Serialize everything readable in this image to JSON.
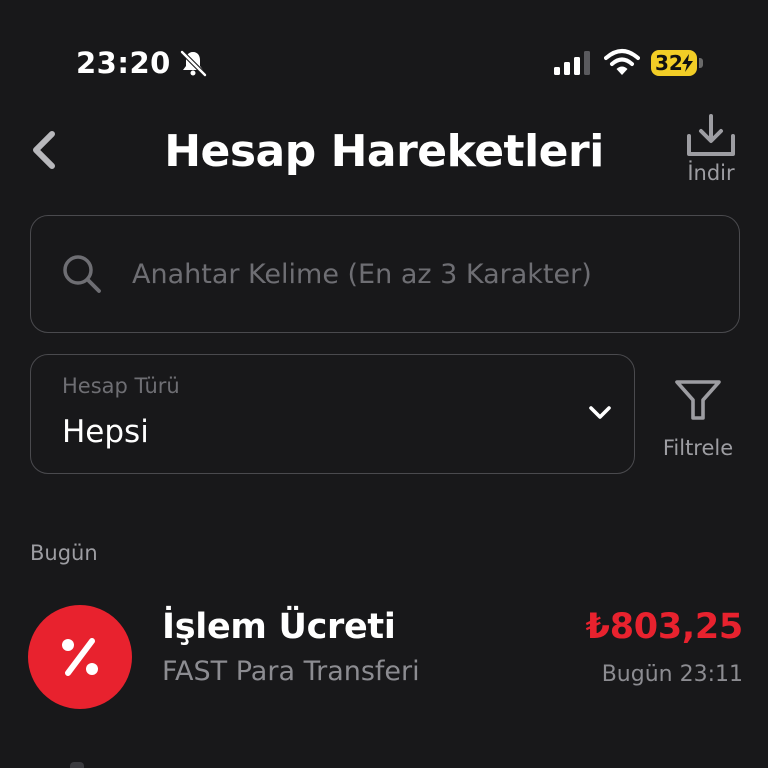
{
  "status_bar": {
    "time": "23:20",
    "battery_level": "32",
    "icons": [
      "bell-slash-icon",
      "cellular-signal-icon",
      "wifi-icon",
      "battery-charging-icon"
    ]
  },
  "header": {
    "title": "Hesap Hareketleri",
    "back_icon": "chevron-left-icon",
    "download_label": "İndir",
    "download_icon": "download-tray-icon"
  },
  "search": {
    "placeholder": "Anahtar Kelime (En az 3 Karakter)",
    "value": "",
    "icon": "search-icon"
  },
  "account_filter": {
    "label": "Hesap Türü",
    "selected": "Hepsi",
    "icon": "chevron-down-icon"
  },
  "filter_button": {
    "label": "Filtrele",
    "icon": "funnel-icon"
  },
  "sections": [
    {
      "date_label": "Bugün",
      "transactions": [
        {
          "title": "İşlem Ücreti",
          "subtitle": "FAST Para Transferi",
          "amount": "₺803,25",
          "time": "Bugün 23:11",
          "icon": "percent-icon",
          "icon_bg": "#e8222e",
          "amount_color": "#e8222e"
        }
      ]
    }
  ],
  "colors": {
    "background": "#18181a",
    "border": "#4a4a4e",
    "muted_text": "#9d9da2",
    "placeholder": "#6e6e73",
    "accent_red": "#e8222e",
    "battery_yellow": "#f2cd26"
  }
}
